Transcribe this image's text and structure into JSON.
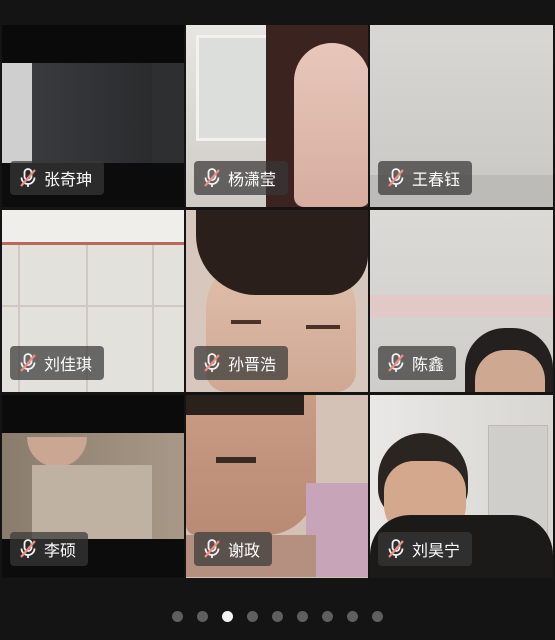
{
  "participants": [
    {
      "name": "张奇珅",
      "muted": true
    },
    {
      "name": "杨潇莹",
      "muted": true
    },
    {
      "name": "王春钰",
      "muted": true
    },
    {
      "name": "刘佳琪",
      "muted": true
    },
    {
      "name": "孙晋浩",
      "muted": true
    },
    {
      "name": "陈鑫",
      "muted": true
    },
    {
      "name": "李硕",
      "muted": true
    },
    {
      "name": "谢政",
      "muted": true
    },
    {
      "name": "刘昊宁",
      "muted": true
    }
  ],
  "pagination": {
    "total_pages": 9,
    "current_page": 3
  },
  "colors": {
    "background": "#141414",
    "badge": "rgba(55,55,55,0.72)",
    "muted_icon": "#f28b82"
  }
}
